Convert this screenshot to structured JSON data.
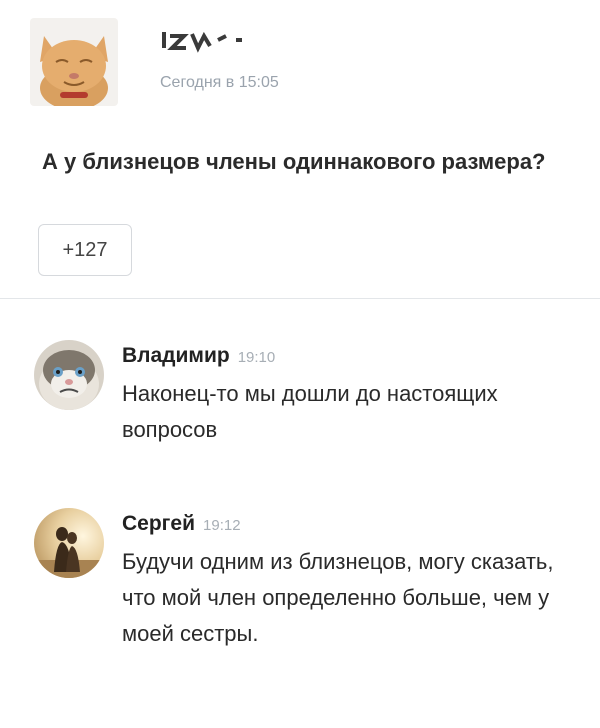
{
  "post": {
    "avatar_icon": "cat-avatar-icon",
    "author_name_icon": "redacted-name-icon",
    "time": "Сегодня в 15:05",
    "text": "А у близнецов члены одиннакового размера?",
    "like_count": "+127"
  },
  "comments": [
    {
      "avatar_icon": "grumpy-cat-avatar-icon",
      "name": "Владимир",
      "time": "19:10",
      "text": "Наконец-то мы дошли до настоящих вопросов"
    },
    {
      "avatar_icon": "couple-avatar-icon",
      "name": "Сергей",
      "time": "19:12",
      "text": "Будучи одним из близнецов, могу сказать, что мой член определенно больше, чем у моей сестры."
    }
  ],
  "colors": {
    "muted": "#9aa3ad",
    "divider": "#e3e6e9"
  }
}
